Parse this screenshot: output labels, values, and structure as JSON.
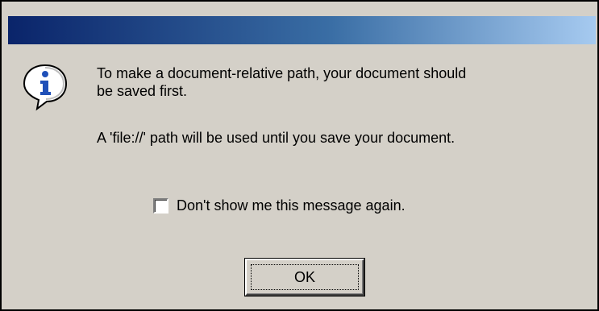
{
  "dialog": {
    "title": "",
    "icon": "info-icon",
    "message_lines": [
      "To make a document-relative path, your document should",
      "be saved first."
    ],
    "secondary_message": "A 'file://' path will be used until you save your document.",
    "checkbox": {
      "label": "Don't show me this message again.",
      "checked": false
    },
    "ok_button_label": "OK"
  },
  "colors": {
    "dialog_background": "#d4d0c8",
    "titlebar_start": "#0a246a",
    "titlebar_end": "#a6caf0",
    "icon_blue": "#2050b8"
  }
}
